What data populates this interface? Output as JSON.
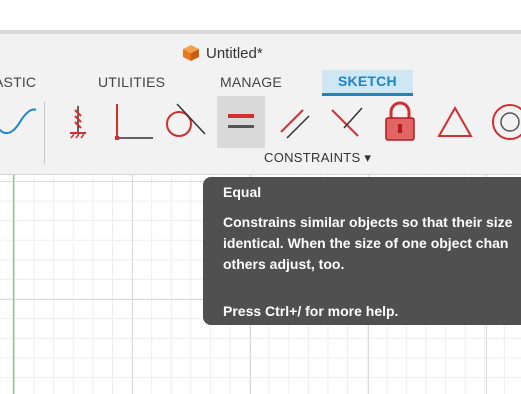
{
  "window": {
    "title": "Untitled*"
  },
  "tabs": [
    {
      "label": "ASTIC"
    },
    {
      "label": "UTILITIES"
    },
    {
      "label": "MANAGE"
    },
    {
      "label": "SKETCH",
      "active": true
    }
  ],
  "toolbar": {
    "group_label": "CONSTRAINTS ▾",
    "tools": [
      {
        "name": "spline",
        "icon": "spline-icon"
      },
      {
        "name": "fix",
        "icon": "fix-icon"
      },
      {
        "name": "perpendicular",
        "icon": "perpendicular-icon"
      },
      {
        "name": "tangent",
        "icon": "tangent-icon"
      },
      {
        "name": "equal",
        "icon": "equal-icon",
        "hovered": true
      },
      {
        "name": "parallel",
        "icon": "parallel-icon"
      },
      {
        "name": "perpendicular-lines",
        "icon": "perpendicular-lines-icon"
      },
      {
        "name": "lock",
        "icon": "lock-icon"
      },
      {
        "name": "triangle",
        "icon": "triangle-icon"
      },
      {
        "name": "concentric",
        "icon": "concentric-icon"
      }
    ]
  },
  "tooltip": {
    "title": "Equal",
    "body": "Constrains similar objects so that their size\nidentical. When the size of one object chan\nothers adjust, too.",
    "help": "Press Ctrl+/ for more help."
  },
  "colors": {
    "accent": "#1b86c6",
    "constraint_red": "#d32f2f",
    "tooltip_bg": "#505050"
  }
}
